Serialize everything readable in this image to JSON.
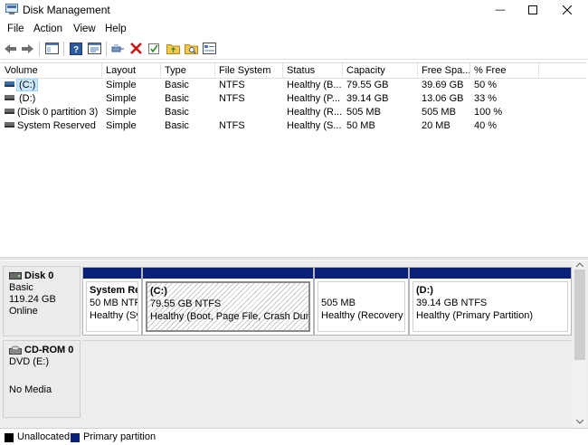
{
  "window": {
    "title": "Disk Management",
    "min_glyph": "—",
    "max_glyph": "☐",
    "close_glyph": "✕"
  },
  "menu": [
    "File",
    "Action",
    "View",
    "Help"
  ],
  "toolbar": {
    "icons": [
      "back-arrow-icon",
      "forward-arrow-icon",
      "console-tree-icon",
      "help-icon",
      "properties-icon",
      "connect-icon",
      "delete-icon",
      "check-icon",
      "folder-up-icon",
      "folder-search-icon",
      "view-icon"
    ]
  },
  "volume_list": {
    "columns": [
      "Volume",
      "Layout",
      "Type",
      "File System",
      "Status",
      "Capacity",
      "Free Spa...",
      "% Free"
    ],
    "rows": [
      {
        "volume": "(C:)",
        "layout": "Simple",
        "type": "Basic",
        "fs": "NTFS",
        "status": "Healthy (B...",
        "capacity": "79.55 GB",
        "free": "39.69 GB",
        "pct": "50 %",
        "selected": true
      },
      {
        "volume": "(D:)",
        "layout": "Simple",
        "type": "Basic",
        "fs": "NTFS",
        "status": "Healthy (P...",
        "capacity": "39.14 GB",
        "free": "13.06 GB",
        "pct": "33 %"
      },
      {
        "volume": "(Disk 0 partition 3)",
        "layout": "Simple",
        "type": "Basic",
        "fs": "",
        "status": "Healthy (R...",
        "capacity": "505 MB",
        "free": "505 MB",
        "pct": "100 %"
      },
      {
        "volume": "System Reserved",
        "layout": "Simple",
        "type": "Basic",
        "fs": "NTFS",
        "status": "Healthy (S...",
        "capacity": "50 MB",
        "free": "20 MB",
        "pct": "40 %"
      }
    ]
  },
  "disks": [
    {
      "name": "Disk 0",
      "lines": [
        "Basic",
        "119.24 GB",
        "Online"
      ],
      "partitions": [
        {
          "title": "System Re",
          "size": "50 MB NTFS",
          "status": "Healthy (Sy"
        },
        {
          "title": "(C:)",
          "size": "79.55 GB NTFS",
          "status": "Healthy (Boot, Page File, Crash Dump,"
        },
        {
          "title": "",
          "size": "505 MB",
          "status": "Healthy (Recovery P"
        },
        {
          "title": "(D:)",
          "size": "39.14 GB NTFS",
          "status": "Healthy (Primary Partition)"
        }
      ]
    },
    {
      "name": "CD-ROM 0",
      "lines": [
        "DVD (E:)",
        "",
        "No Media"
      ]
    }
  ],
  "legend": [
    {
      "label": "Unallocated",
      "color": "#000000"
    },
    {
      "label": "Primary partition",
      "color": "#0a1f78"
    }
  ],
  "colors": {
    "primary_partition": "#0a1f78",
    "selection": "#cce8ff",
    "selection_border": "#99d1ff"
  }
}
